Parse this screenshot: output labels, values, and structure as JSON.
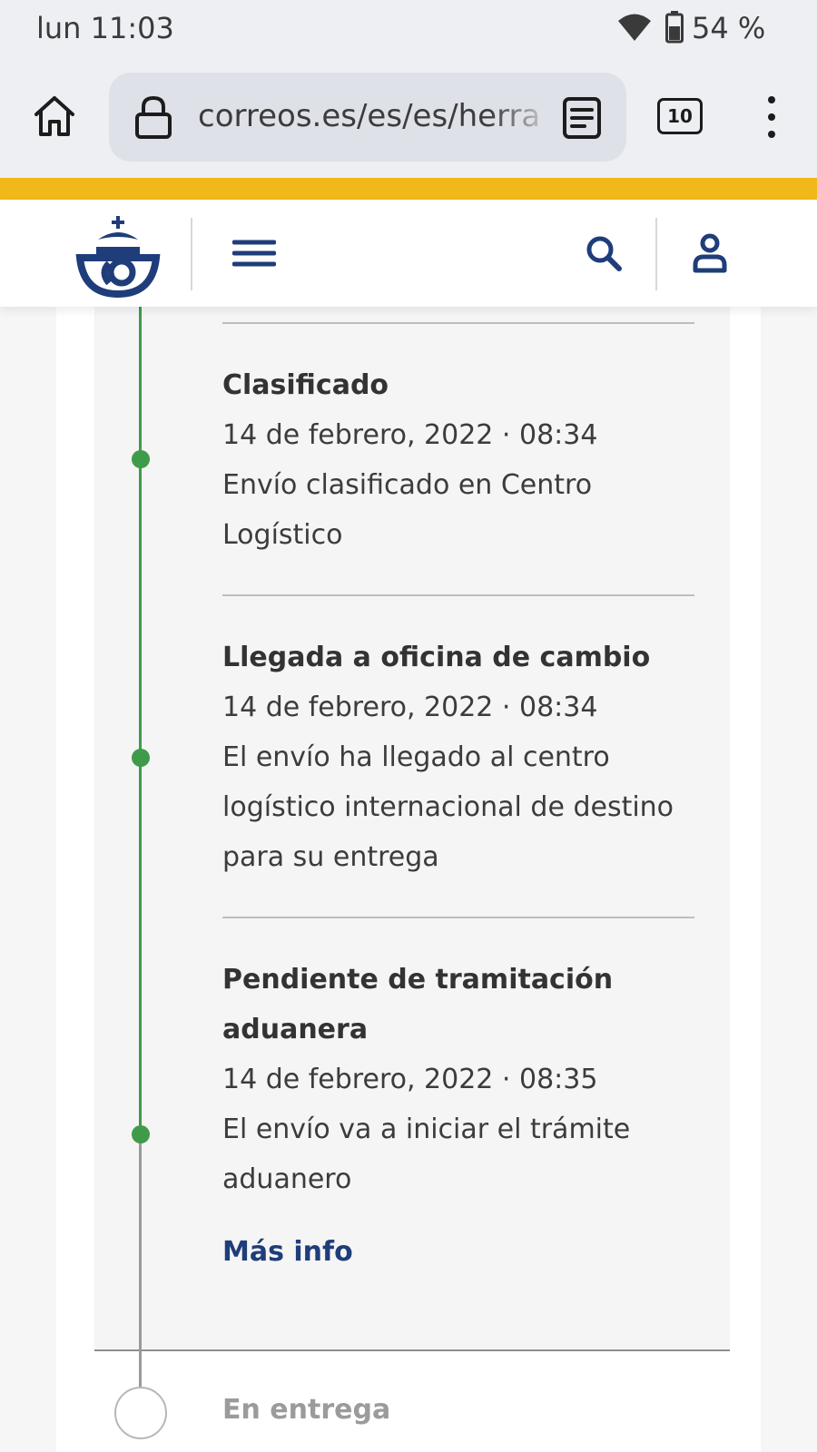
{
  "status_bar": {
    "time": "lun 11:03",
    "battery": "54 %"
  },
  "browser": {
    "url": "correos.es/es/es/herra",
    "tab_count": "10"
  },
  "site": {
    "brand_color": "#1f3d7a",
    "accent_color": "#f0b818"
  },
  "timeline": {
    "completed_color": "#3f9b4a",
    "events": [
      {
        "title_lines": [
          "Clasificado"
        ],
        "date": "14 de febrero, 2022 · 08:34",
        "description_lines": [
          "Envío clasificado en Centro",
          "Logístico"
        ]
      },
      {
        "title_lines": [
          "Llegada a oficina de cambio"
        ],
        "date": "14 de febrero, 2022 · 08:34",
        "description_lines": [
          "El envío ha llegado al centro",
          "logístico internacional de destino",
          "para su entrega"
        ]
      },
      {
        "title_lines": [
          "Pendiente de tramitación",
          "aduanera"
        ],
        "date": "14 de febrero, 2022 · 08:35",
        "description_lines": [
          "El envío va a iniciar el trámite",
          "aduanero"
        ]
      }
    ],
    "more_info": "Más info",
    "next_step": "En entrega"
  },
  "icons": [
    "wifi-icon",
    "battery-icon",
    "home-icon",
    "lock-icon",
    "reader-mode-icon",
    "menu-dots-icon",
    "correos-logo-icon",
    "hamburger-icon",
    "search-icon",
    "user-icon"
  ]
}
